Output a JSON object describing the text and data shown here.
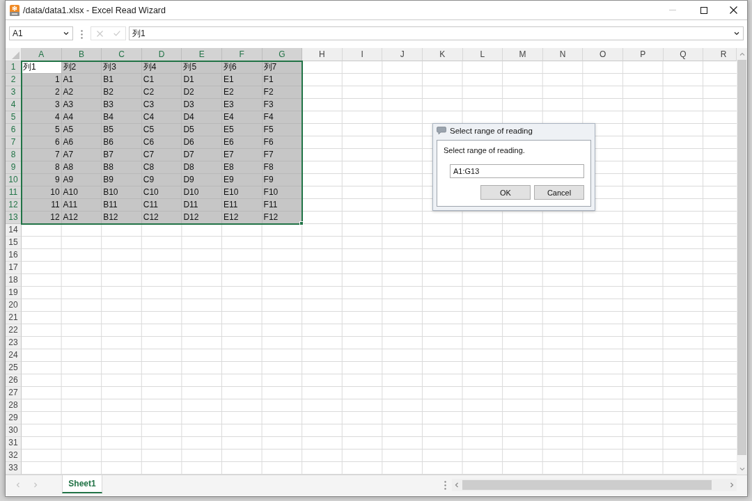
{
  "window": {
    "title": "/data/data1.xlsx - Excel Read Wizard",
    "controls": [
      {
        "kind": "minimize",
        "disabled": true
      },
      {
        "kind": "maximize",
        "disabled": false
      },
      {
        "kind": "close",
        "disabled": false
      }
    ]
  },
  "formula_bar": {
    "name_box": "A1",
    "actions": [
      {
        "kind": "cancel",
        "disabled": true
      },
      {
        "kind": "enter",
        "disabled": true
      }
    ],
    "formula": "列1"
  },
  "sheet": {
    "columns": [
      {
        "label": "A",
        "selected": true
      },
      {
        "label": "B",
        "selected": true
      },
      {
        "label": "C",
        "selected": true
      },
      {
        "label": "D",
        "selected": true
      },
      {
        "label": "E",
        "selected": true
      },
      {
        "label": "F",
        "selected": true
      },
      {
        "label": "G",
        "selected": true
      },
      {
        "label": "H",
        "selected": false
      },
      {
        "label": "I",
        "selected": false
      },
      {
        "label": "J",
        "selected": false
      },
      {
        "label": "K",
        "selected": false
      },
      {
        "label": "L",
        "selected": false
      },
      {
        "label": "M",
        "selected": false
      },
      {
        "label": "N",
        "selected": false
      },
      {
        "label": "O",
        "selected": false
      },
      {
        "label": "P",
        "selected": false
      },
      {
        "label": "Q",
        "selected": false
      },
      {
        "label": "R",
        "selected": false
      }
    ],
    "rows": [
      {
        "header": "1",
        "selected": true,
        "cells": [
          "列1",
          "列2",
          "列3",
          "列4",
          "列5",
          "列6",
          "列7"
        ]
      },
      {
        "header": "2",
        "selected": true,
        "cells": [
          {
            "value": "1",
            "kind": "number"
          },
          "A1",
          "B1",
          "C1",
          "D1",
          "E1",
          "F1"
        ]
      },
      {
        "header": "3",
        "selected": true,
        "cells": [
          {
            "value": "2",
            "kind": "number"
          },
          "A2",
          "B2",
          "C2",
          "D2",
          "E2",
          "F2"
        ]
      },
      {
        "header": "4",
        "selected": true,
        "cells": [
          {
            "value": "3",
            "kind": "number"
          },
          "A3",
          "B3",
          "C3",
          "D3",
          "E3",
          "F3"
        ]
      },
      {
        "header": "5",
        "selected": true,
        "cells": [
          {
            "value": "4",
            "kind": "number"
          },
          "A4",
          "B4",
          "C4",
          "D4",
          "E4",
          "F4"
        ]
      },
      {
        "header": "6",
        "selected": true,
        "cells": [
          {
            "value": "5",
            "kind": "number"
          },
          "A5",
          "B5",
          "C5",
          "D5",
          "E5",
          "F5"
        ]
      },
      {
        "header": "7",
        "selected": true,
        "cells": [
          {
            "value": "6",
            "kind": "number"
          },
          "A6",
          "B6",
          "C6",
          "D6",
          "E6",
          "F6"
        ]
      },
      {
        "header": "8",
        "selected": true,
        "cells": [
          {
            "value": "7",
            "kind": "number"
          },
          "A7",
          "B7",
          "C7",
          "D7",
          "E7",
          "F7"
        ]
      },
      {
        "header": "9",
        "selected": true,
        "cells": [
          {
            "value": "8",
            "kind": "number"
          },
          "A8",
          "B8",
          "C8",
          "D8",
          "E8",
          "F8"
        ]
      },
      {
        "header": "10",
        "selected": true,
        "cells": [
          {
            "value": "9",
            "kind": "number"
          },
          "A9",
          "B9",
          "C9",
          "D9",
          "E9",
          "F9"
        ]
      },
      {
        "header": "11",
        "selected": true,
        "cells": [
          {
            "value": "10",
            "kind": "number"
          },
          "A10",
          "B10",
          "C10",
          "D10",
          "E10",
          "F10"
        ]
      },
      {
        "header": "12",
        "selected": true,
        "cells": [
          {
            "value": "11",
            "kind": "number"
          },
          "A11",
          "B11",
          "C11",
          "D11",
          "E11",
          "F11"
        ]
      },
      {
        "header": "13",
        "selected": true,
        "cells": [
          {
            "value": "12",
            "kind": "number"
          },
          "A12",
          "B12",
          "C12",
          "D12",
          "E12",
          "F12"
        ]
      },
      {
        "header": "14",
        "selected": false
      },
      {
        "header": "15",
        "selected": false
      },
      {
        "header": "16",
        "selected": false
      },
      {
        "header": "17",
        "selected": false
      },
      {
        "header": "18",
        "selected": false
      },
      {
        "header": "19",
        "selected": false
      },
      {
        "header": "20",
        "selected": false
      },
      {
        "header": "21",
        "selected": false
      },
      {
        "header": "22",
        "selected": false
      },
      {
        "header": "23",
        "selected": false
      },
      {
        "header": "24",
        "selected": false
      },
      {
        "header": "25",
        "selected": false
      },
      {
        "header": "26",
        "selected": false
      },
      {
        "header": "27",
        "selected": false
      },
      {
        "header": "28",
        "selected": false
      },
      {
        "header": "29",
        "selected": false
      },
      {
        "header": "30",
        "selected": false
      },
      {
        "header": "31",
        "selected": false
      },
      {
        "header": "32",
        "selected": false
      },
      {
        "header": "33",
        "selected": false
      }
    ]
  },
  "sheet_nav": [
    {
      "kind": "previous",
      "disabled": true
    },
    {
      "kind": "next",
      "disabled": true
    }
  ],
  "sheet_tabs": [
    {
      "label": "Sheet1",
      "selected": true
    }
  ],
  "dialog": {
    "title": "Select range of reading",
    "message": "Select range of reading.",
    "range_value": "A1:G13",
    "buttons": [
      "OK",
      "Cancel"
    ]
  }
}
